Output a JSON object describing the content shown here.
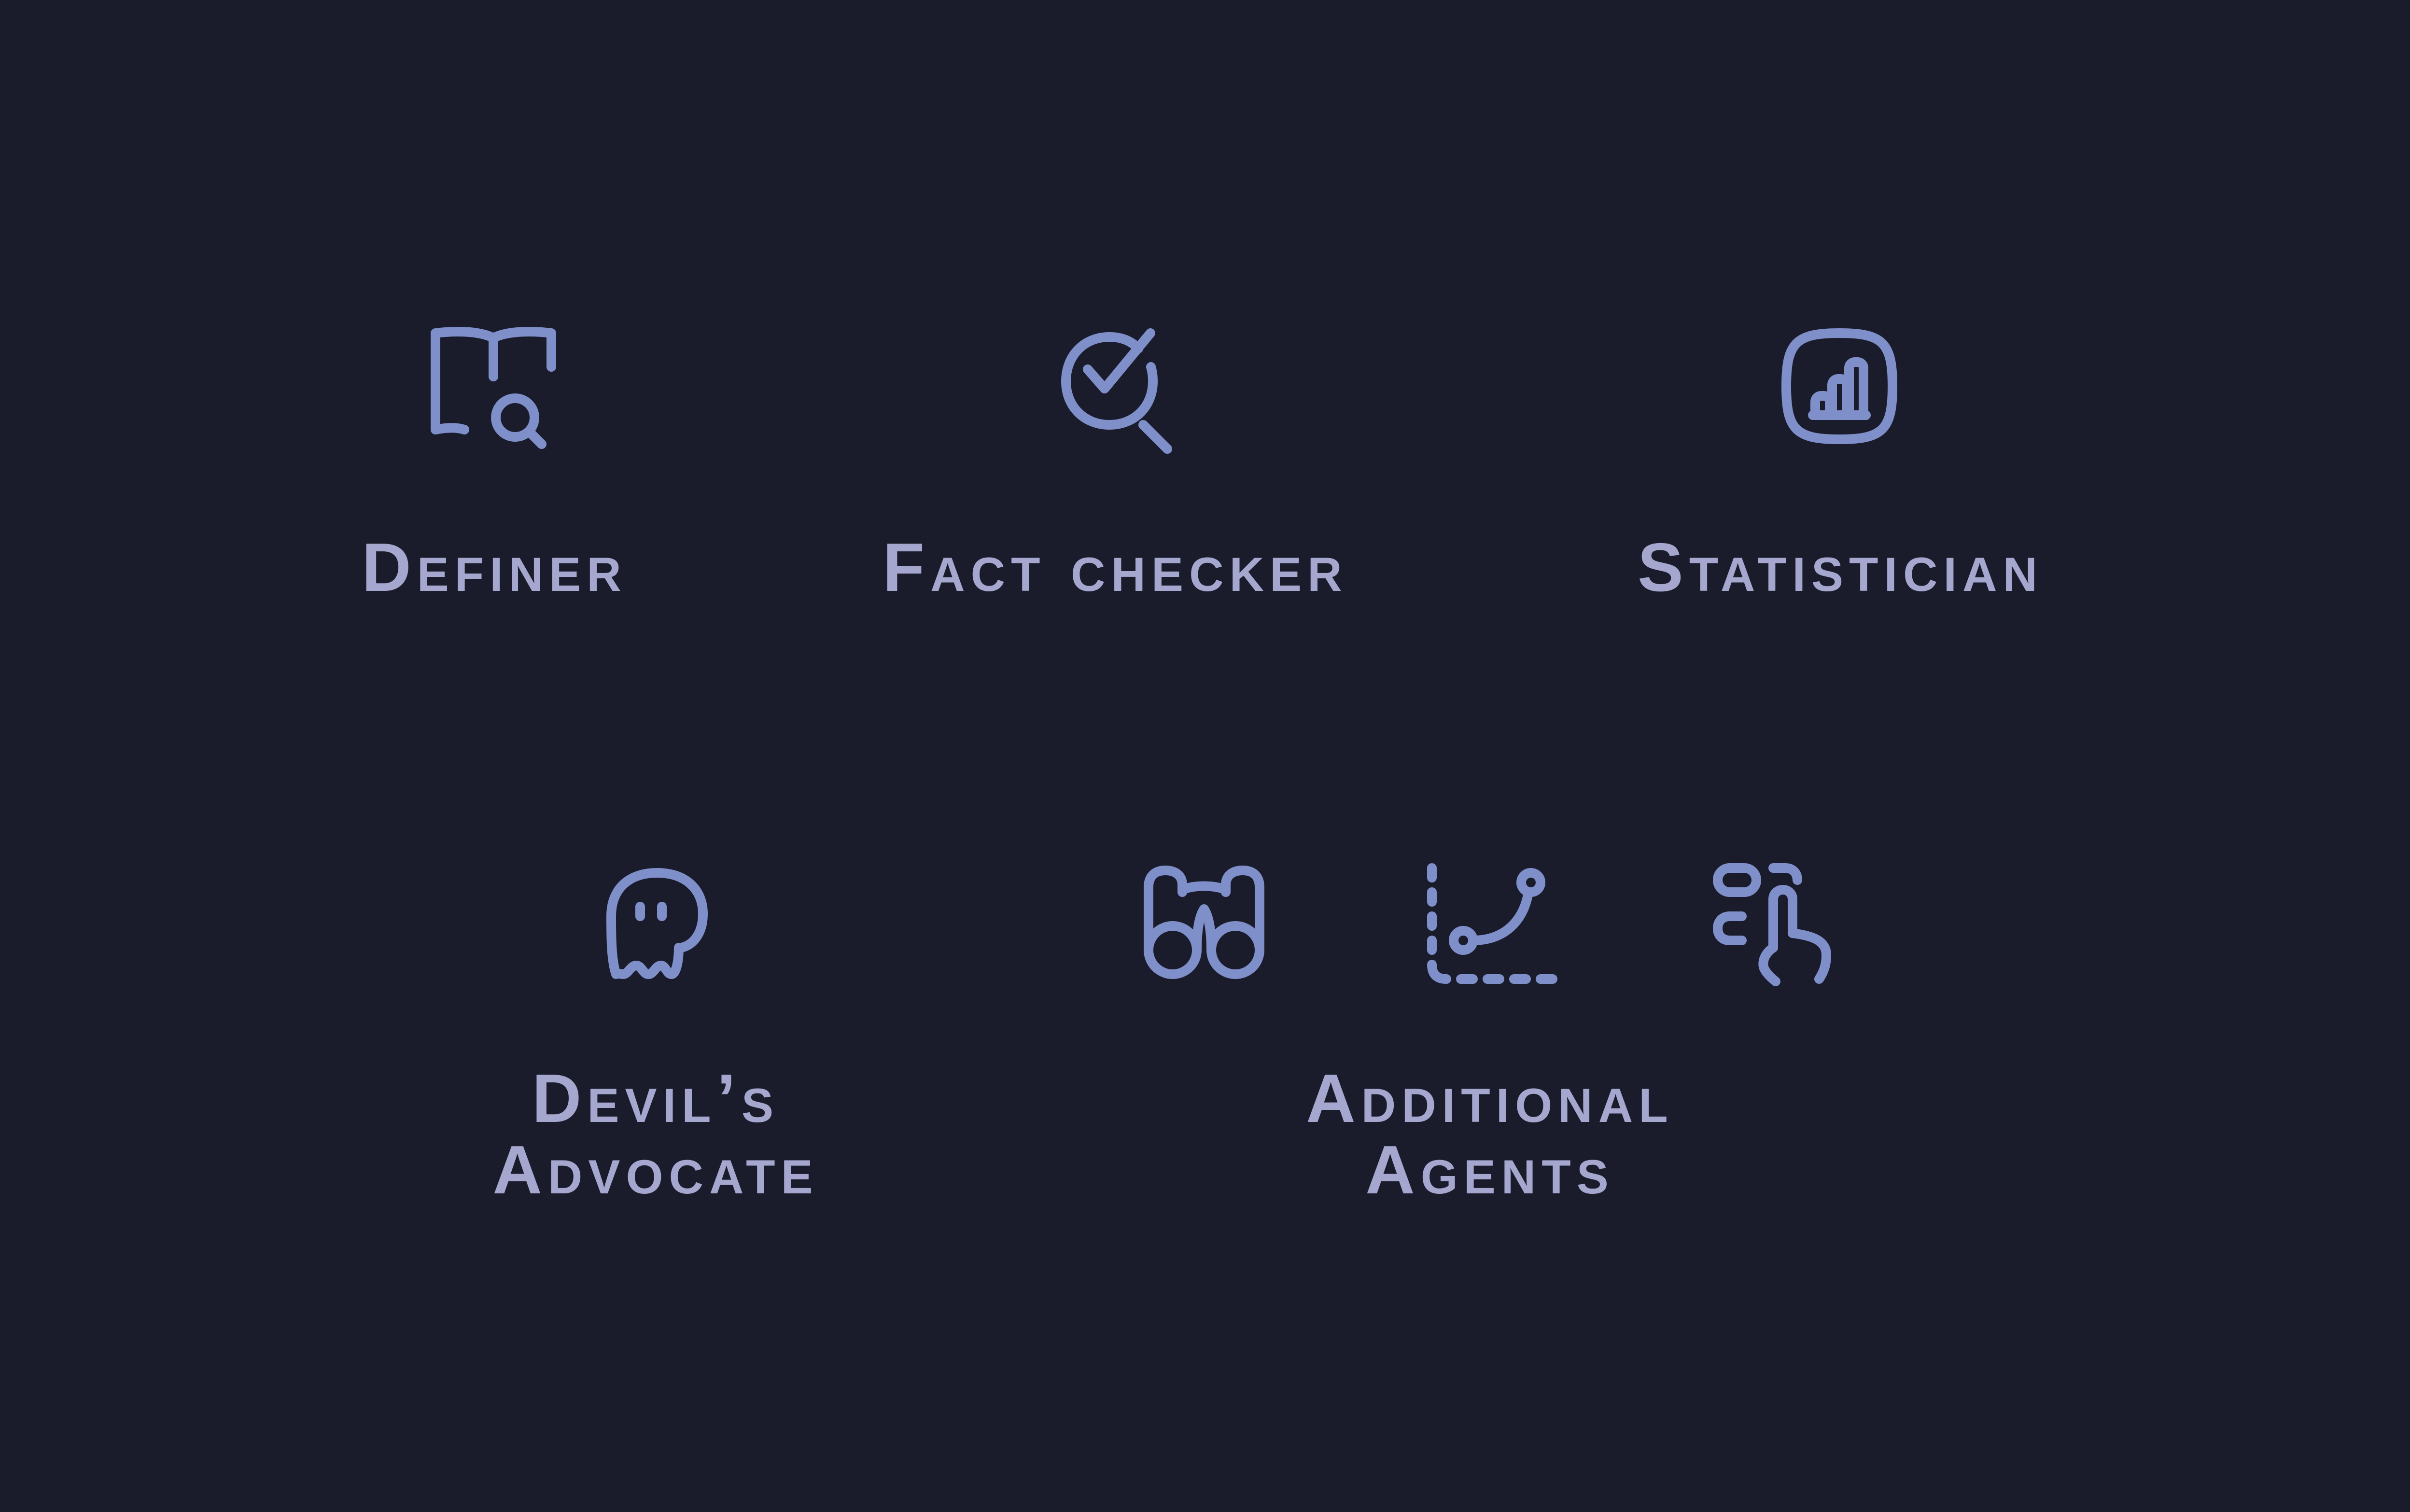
{
  "agents": {
    "definer": {
      "label": "Definer",
      "icon": "book-search-icon"
    },
    "fact_checker": {
      "label": "Fact checker",
      "icon": "check-search-icon"
    },
    "statistician": {
      "label": "Statistician",
      "icon": "bar-chart-icon"
    },
    "devils_advocate": {
      "label_line1": "Devil’s",
      "label_line2": "Advocate",
      "icon": "ghost-icon"
    },
    "additional_agents": {
      "label_line1": "Additional",
      "label_line2": "Agents",
      "icons": [
        "binoculars-icon",
        "route-graph-icon",
        "hand-pointer-select-icon"
      ]
    }
  },
  "colors": {
    "background": "#1a1c2c",
    "icon_stroke": "#7f8fc9",
    "label_text": "#a6a7cf"
  }
}
